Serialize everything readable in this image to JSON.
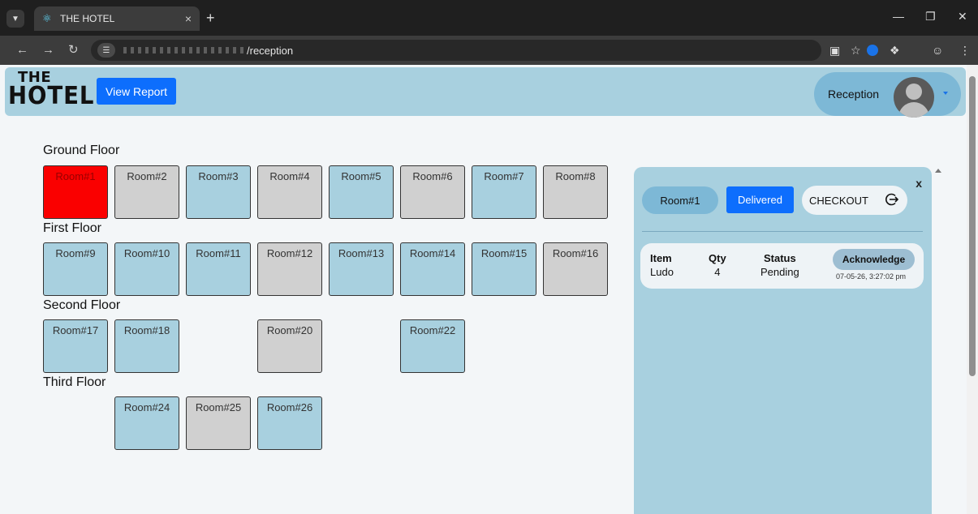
{
  "browser": {
    "tab_title": "THE HOTEL",
    "tab_close": "×",
    "new_tab": "+",
    "url_path": "/reception"
  },
  "header": {
    "logo_line1": "THE",
    "logo_line2": "HOTEL",
    "report_button": "View Report",
    "role_label": "Reception"
  },
  "floors": [
    {
      "title": "Ground Floor",
      "rooms": [
        {
          "label": "Room#1",
          "status": "red"
        },
        {
          "label": "Room#2",
          "status": "gray"
        },
        {
          "label": "Room#3",
          "status": "blue"
        },
        {
          "label": "Room#4",
          "status": "gray"
        },
        {
          "label": "Room#5",
          "status": "blue"
        },
        {
          "label": "Room#6",
          "status": "gray"
        },
        {
          "label": "Room#7",
          "status": "blue"
        },
        {
          "label": "Room#8",
          "status": "gray"
        }
      ]
    },
    {
      "title": "First Floor",
      "rooms": [
        {
          "label": "Room#9",
          "status": "blue"
        },
        {
          "label": "Room#10",
          "status": "blue"
        },
        {
          "label": "Room#11",
          "status": "blue"
        },
        {
          "label": "Room#12",
          "status": "gray"
        },
        {
          "label": "Room#13",
          "status": "blue"
        },
        {
          "label": "Room#14",
          "status": "blue"
        },
        {
          "label": "Room#15",
          "status": "blue"
        },
        {
          "label": "Room#16",
          "status": "gray"
        }
      ]
    },
    {
      "title": "Second Floor",
      "rooms": [
        {
          "label": "Room#17",
          "status": "blue"
        },
        {
          "label": "Room#18",
          "status": "blue"
        },
        {
          "label": "Room#20",
          "status": "gray"
        },
        {
          "label": "Room#22",
          "status": "blue"
        }
      ]
    },
    {
      "title": "Third Floor",
      "rooms": [
        {
          "label": "Room#24",
          "status": "blue"
        },
        {
          "label": "Room#25",
          "status": "gray"
        },
        {
          "label": "Room#26",
          "status": "blue"
        }
      ]
    }
  ],
  "panel": {
    "close": "x",
    "room": "Room#1",
    "delivered_button": "Delivered",
    "checkout_button": "CHECKOUT",
    "order": {
      "headers": {
        "item": "Item",
        "qty": "Qty",
        "status": "Status"
      },
      "item": "Ludo",
      "qty": "4",
      "status": "Pending",
      "acknowledge_button": "Acknowledge",
      "timestamp": "07-05-26, 3:27:02 pm"
    }
  },
  "colors": {
    "header_bg": "#a8d0df",
    "room_available": "#a8d0df",
    "room_occupied": "#d0d0d0",
    "room_alert": "#fa0000",
    "primary_button": "#0d6efd"
  }
}
